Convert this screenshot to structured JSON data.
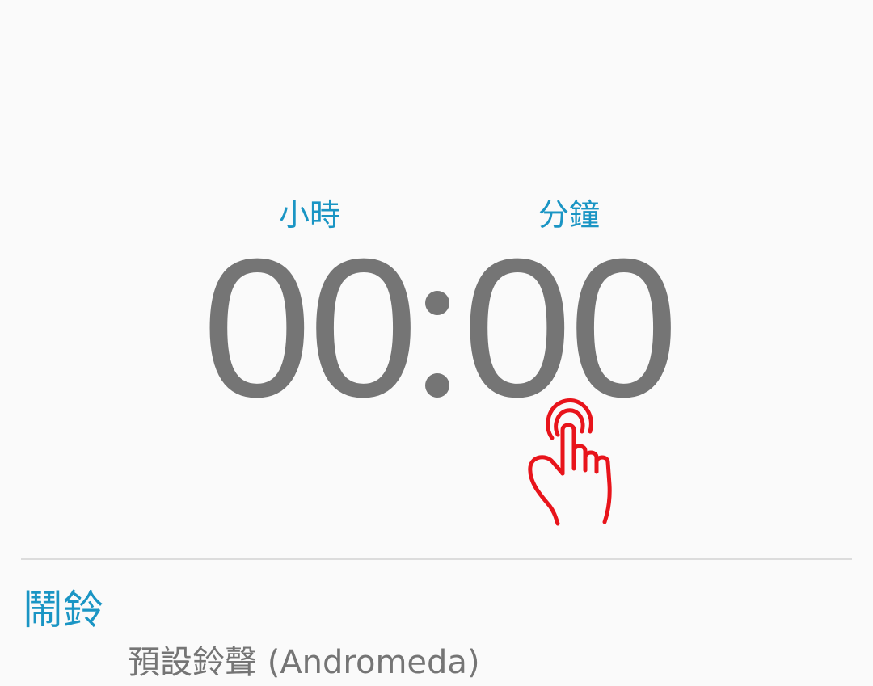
{
  "timer": {
    "hours_label": "小時",
    "minutes_label": "分鐘",
    "hours_value": "00",
    "separator": ":",
    "minutes_value": "00"
  },
  "alarm": {
    "section_title": "鬧鈴",
    "ringtone": "預設鈴聲 (Andromeda)"
  },
  "colors": {
    "accent": "#1a95c4",
    "digits": "#757575",
    "background": "#fafafa",
    "hand_overlay": "#e8141b"
  },
  "icons": {
    "tap_hint": "pointing-hand-icon"
  }
}
